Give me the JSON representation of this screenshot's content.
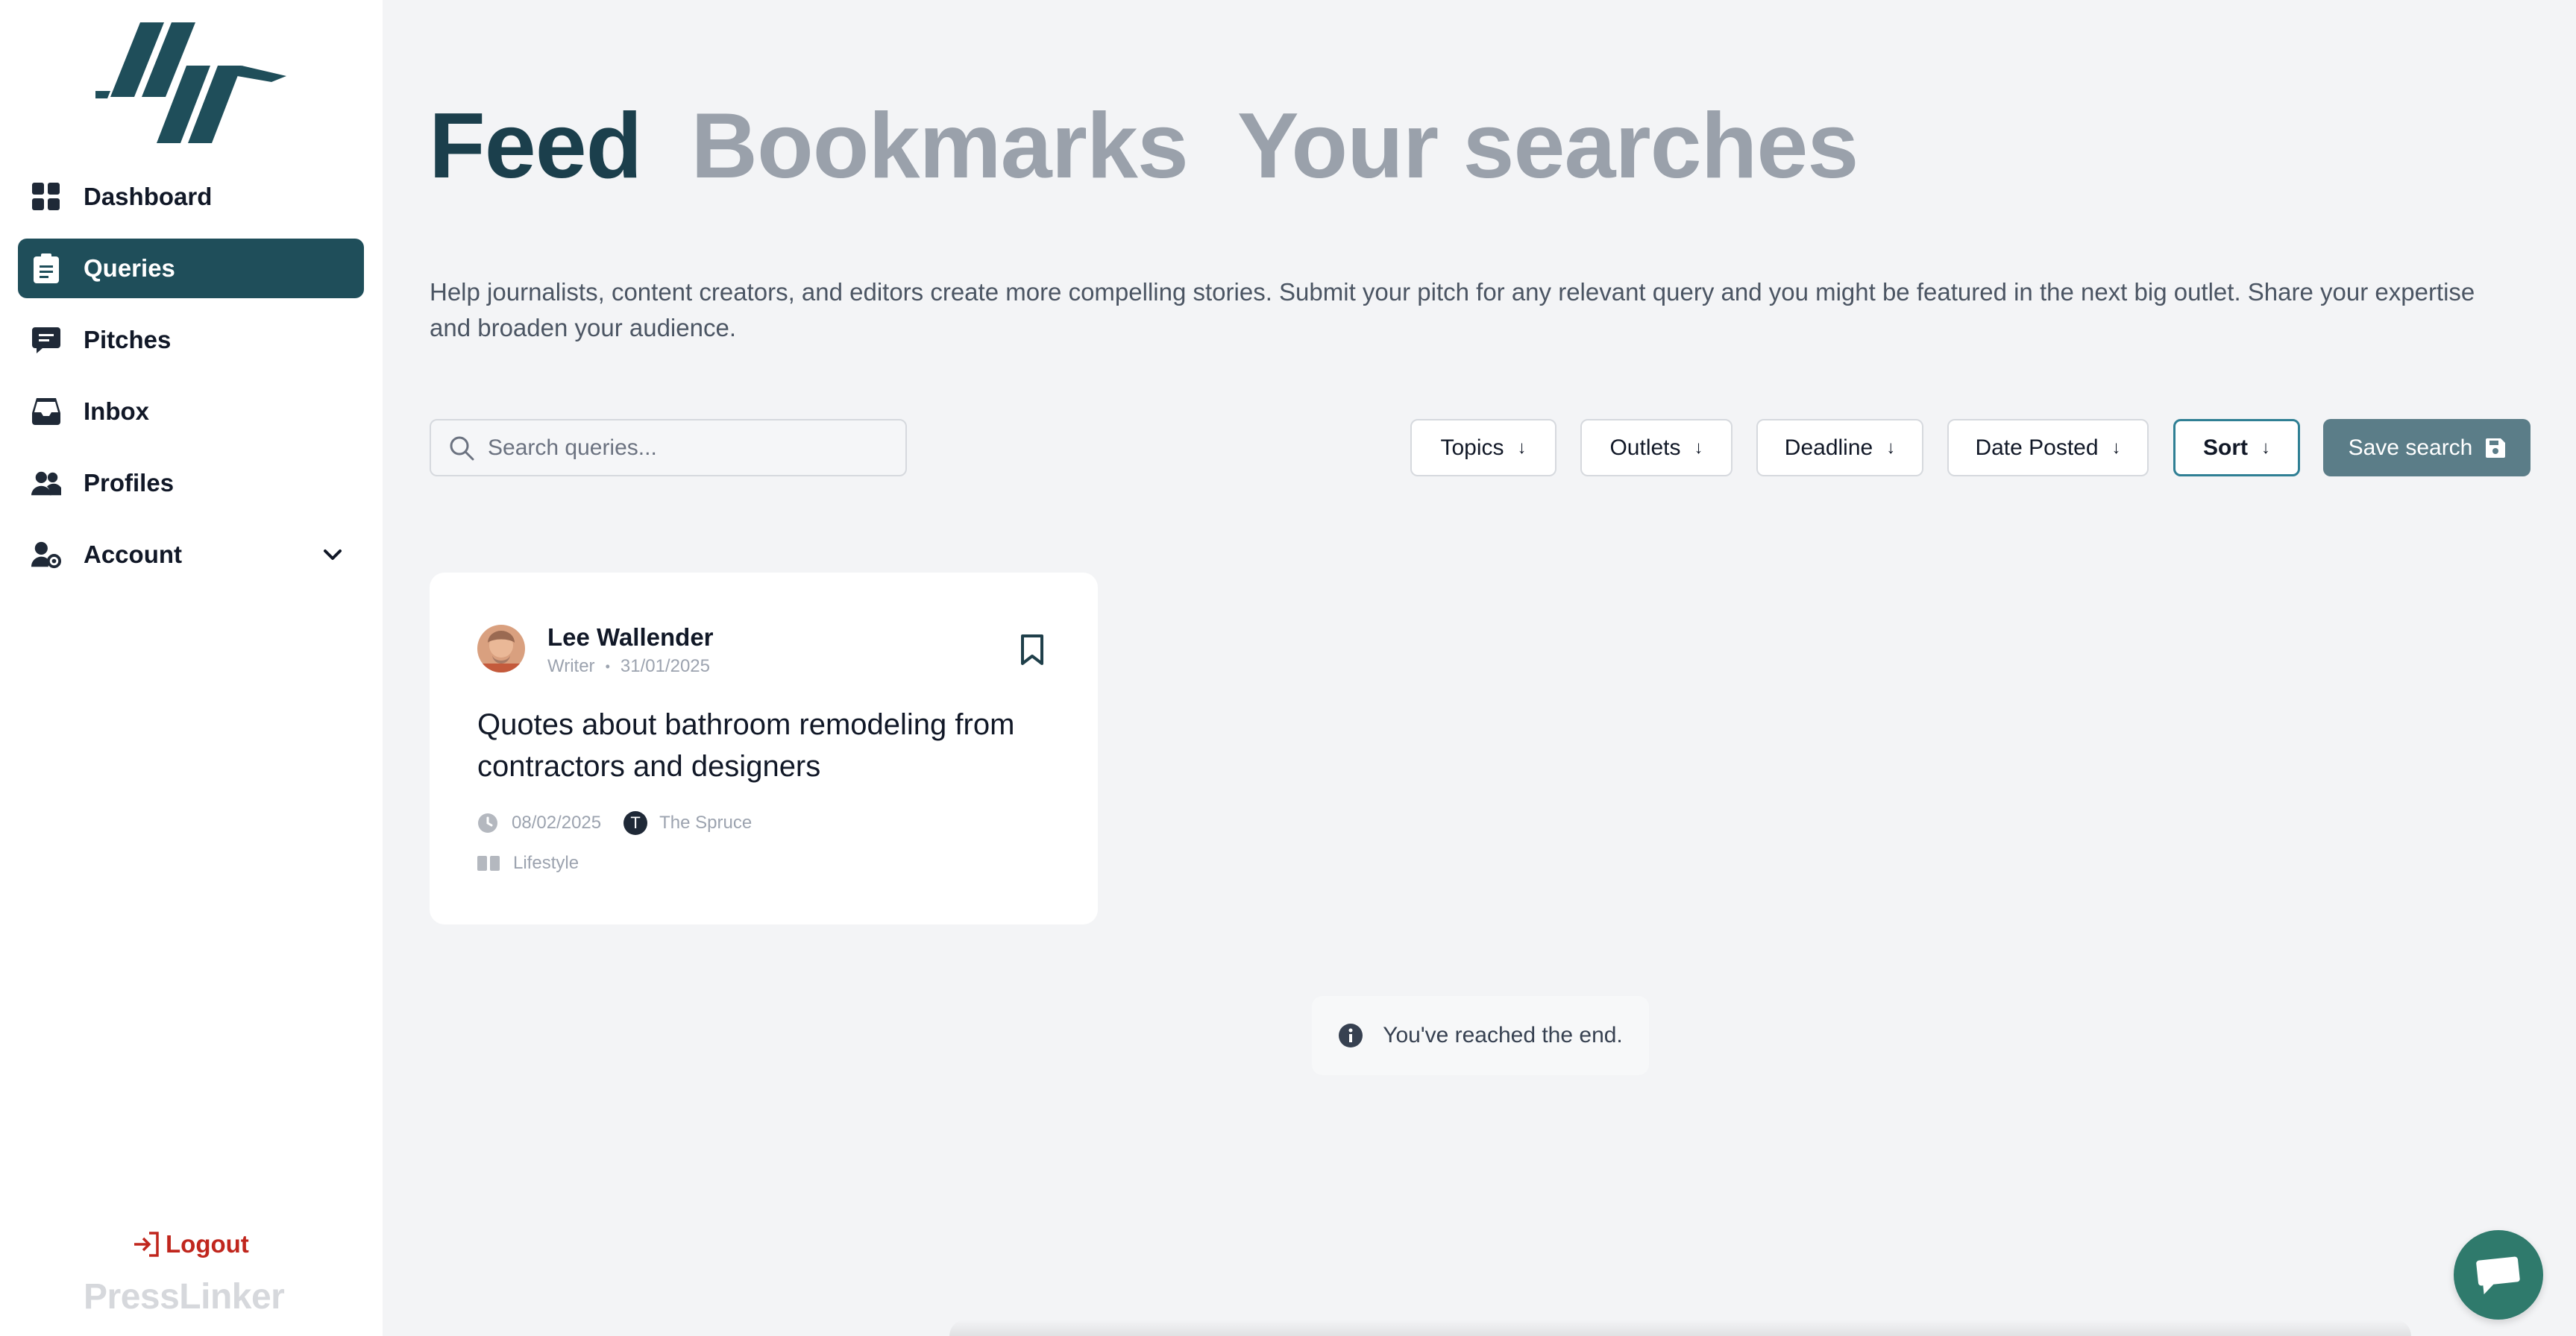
{
  "sidebar": {
    "items": [
      {
        "label": "Dashboard",
        "icon": "grid-icon"
      },
      {
        "label": "Queries",
        "icon": "clipboard-icon"
      },
      {
        "label": "Pitches",
        "icon": "message-icon"
      },
      {
        "label": "Inbox",
        "icon": "inbox-icon"
      },
      {
        "label": "Profiles",
        "icon": "users-icon"
      },
      {
        "label": "Account",
        "icon": "user-gear-icon"
      }
    ],
    "logout_label": "Logout",
    "brand": "PressLinker"
  },
  "tabs": [
    {
      "label": "Feed",
      "active": true
    },
    {
      "label": "Bookmarks",
      "active": false
    },
    {
      "label": "Your searches",
      "active": false
    }
  ],
  "description": "Help journalists, content creators, and editors create more compelling stories. Submit your pitch for any relevant query and you might be featured in the next big outlet. Share your expertise and broaden your audience.",
  "search": {
    "placeholder": "Search queries..."
  },
  "filters": {
    "topics": "Topics",
    "outlets": "Outlets",
    "deadline": "Deadline",
    "date_posted": "Date Posted",
    "sort": "Sort",
    "arrow": "↓"
  },
  "save_search_label": "Save search",
  "card": {
    "author": "Lee Wallender",
    "role": "Writer",
    "dot": "•",
    "posted": "31/01/2025",
    "title": "Quotes about bathroom remodeling from contractors and designers",
    "deadline": "08/02/2025",
    "outlet_initial": "T",
    "outlet": "The Spruce",
    "category": "Lifestyle"
  },
  "end_note": "You've reached the end.",
  "colors": {
    "primary": "#1f4e5a",
    "tab_active": "#1b3f4c",
    "logout": "#c0261d",
    "save_button": "#5b7d88",
    "chat": "#2f7a6c"
  }
}
